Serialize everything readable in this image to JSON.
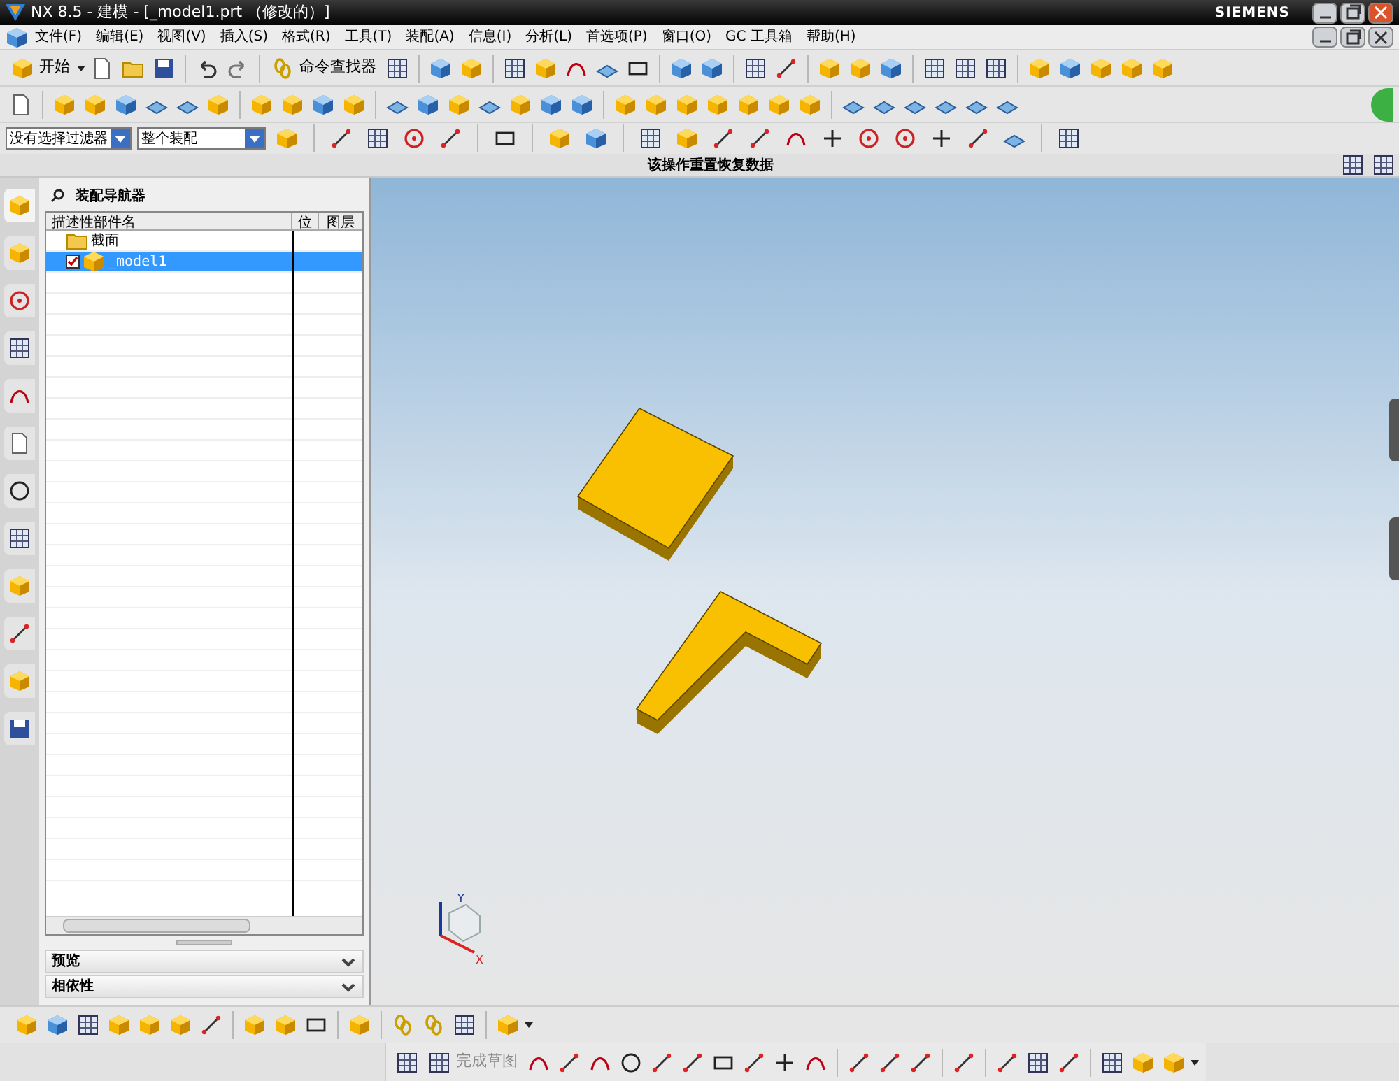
{
  "window": {
    "title": "NX 8.5 - 建模 - [_model1.prt （修改的）]",
    "brand": "SIEMENS"
  },
  "menu": [
    "文件(F)",
    "编辑(E)",
    "视图(V)",
    "插入(S)",
    "格式(R)",
    "工具(T)",
    "装配(A)",
    "信息(I)",
    "分析(L)",
    "首选项(P)",
    "窗口(O)",
    "GC 工具箱",
    "帮助(H)"
  ],
  "toolbar": {
    "start_label": "开始",
    "command_finder_label": "命令查找器"
  },
  "selection_bar": {
    "filter": "没有选择过滤器",
    "scope": "整个装配"
  },
  "status_message": "该操作重置恢复数据",
  "navigator": {
    "title": "装配导航器",
    "columns": [
      "描述性部件名",
      "位",
      "图层"
    ],
    "nodes": [
      {
        "name": "截面",
        "kind": "folder",
        "selected": false
      },
      {
        "name": "_model1",
        "kind": "part",
        "checked": true,
        "selected": true
      }
    ]
  },
  "panels": [
    {
      "title": "预览",
      "expanded": false
    },
    {
      "title": "相依性",
      "expanded": false
    }
  ],
  "triad": {
    "x": "X",
    "y": "Y"
  },
  "sketch_toolbar": {
    "finish_label": "完成草图"
  }
}
